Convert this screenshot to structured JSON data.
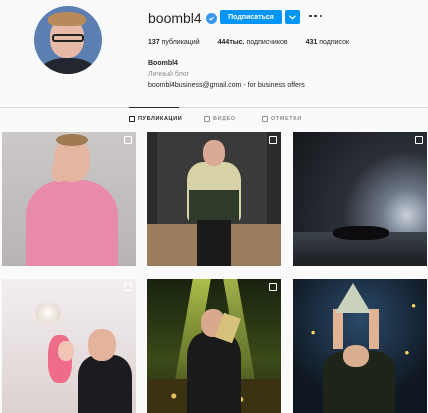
{
  "profile": {
    "username": "boombl4",
    "verified": true,
    "subscribe_label": "Подписаться",
    "more_icon": "more-dots-icon",
    "stats": {
      "posts_count": "137",
      "posts_label": " публикаций",
      "followers_count": "444тыс.",
      "followers_label": " подписчиков",
      "following_count": "431",
      "following_label": " подписок"
    },
    "bio": {
      "name": "Boombl4",
      "category": "Личный блог",
      "line": "boombl4business@gmail.com - for business offers"
    }
  },
  "tabs": [
    {
      "label": "ПУБЛИКАЦИИ",
      "icon": "grid-icon",
      "active": true
    },
    {
      "label": "ВИДЕО",
      "icon": "video-icon",
      "active": false
    },
    {
      "label": "ОТМЕТКИ",
      "icon": "tag-icon",
      "active": false
    }
  ],
  "colors": {
    "accent": "#0095f6",
    "verified": "#3897f0",
    "background": "#fafafa",
    "divider": "#dbdbdb"
  },
  "posts": [
    {
      "icon": "carousel-icon",
      "multi": true
    },
    {
      "icon": "carousel-icon",
      "multi": true
    },
    {
      "icon": "carousel-icon",
      "multi": true
    },
    {
      "icon": "carousel-icon",
      "multi": true
    },
    {
      "icon": "carousel-icon",
      "multi": true
    },
    {
      "icon": "carousel-icon",
      "multi": false
    }
  ]
}
